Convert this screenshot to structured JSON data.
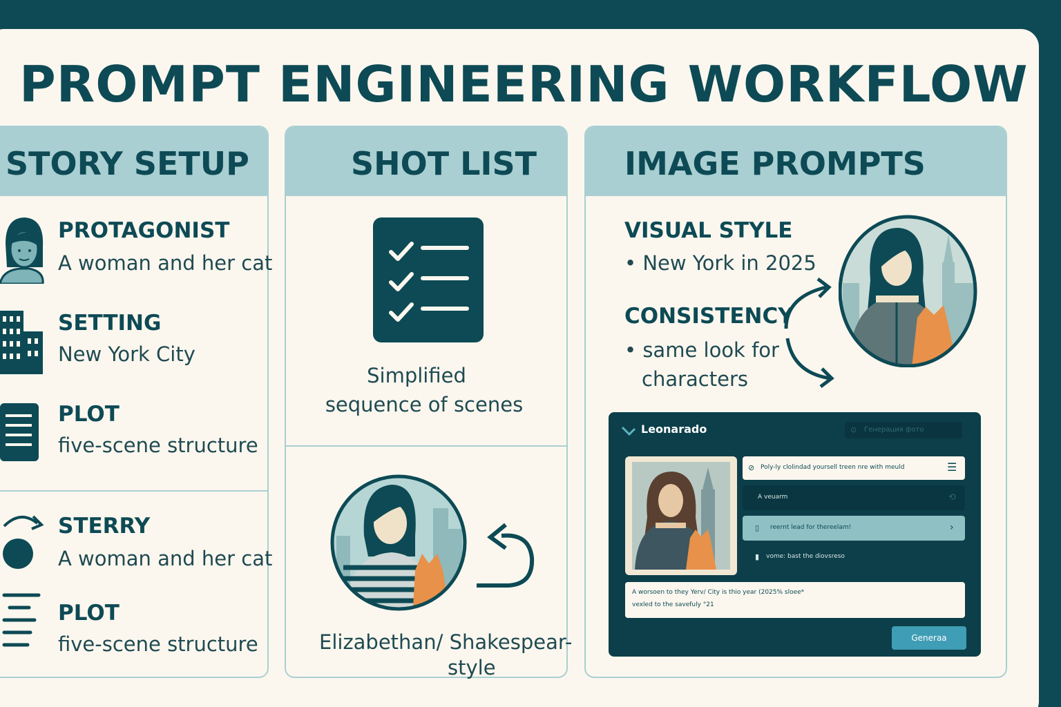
{
  "title": "PROMPT ENGINEERING WORKFLOW",
  "colors": {
    "dark": "#0d4a55",
    "light": "#a9cfd2",
    "paper": "#fbf7ee",
    "cat": "#e8914a"
  },
  "story_setup": {
    "title": "STORY SETUP",
    "items": [
      {
        "label": "PROTAGONIST",
        "value": "A woman and her cat",
        "icon": "woman-icon"
      },
      {
        "label": "SETTING",
        "value": "New York City",
        "icon": "buildings-icon"
      },
      {
        "label": "PLOT",
        "value": "five-scene structure",
        "icon": "document-icon"
      }
    ],
    "items2": [
      {
        "label": "STERRY",
        "value": "A woman and her cat",
        "icon": "circle-arrow-icon"
      },
      {
        "label": "PLOT",
        "value": "five-scene structure",
        "icon": "lines-icon"
      }
    ]
  },
  "shot_list": {
    "title": "SHOT LIST",
    "caption_line1": "Simplified",
    "caption_line2": "sequence of scenes",
    "style_line1": "Elizabethan/ Shakespear-",
    "style_line2": "style"
  },
  "image_prompts": {
    "title": "IMAGE PROMPTS",
    "visual_style_label": "VISUAL STYLE",
    "visual_style_value": "• New York in 2025",
    "consistency_label": "CONSISTENCY",
    "consistency_line1": "• same look for",
    "consistency_line2": "characters"
  },
  "app": {
    "name": "Leonarado",
    "search_placeholder": "Генерация фото",
    "prompt_1": "Poly-ly clolindad yoursell treen nre with meuld",
    "prompt_2": "A veuarm",
    "prompt_3": "reernt lead for thereelam!",
    "prompt_4": "vome: bast the diovsreso",
    "textarea_line1": "A worsoen to they Yerv/ City is thio year (2025% sloee*",
    "textarea_line2": "vexled to the savefuly °21",
    "generate_label": "Generaa"
  }
}
